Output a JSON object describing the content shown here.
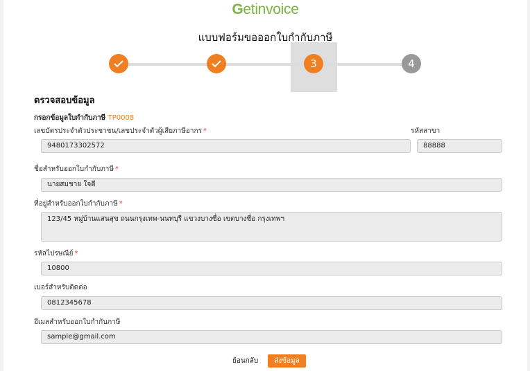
{
  "logo": {
    "g": "G",
    "rest": "etinvoice"
  },
  "form_title": "แบบฟอร์มขอออกใบกำกับภาษี",
  "steps": [
    {
      "state": "done",
      "label": ""
    },
    {
      "state": "done",
      "label": ""
    },
    {
      "state": "active",
      "label": "3"
    },
    {
      "state": "todo",
      "label": "4"
    }
  ],
  "section_title": "ตรวจสอบข้อมูล",
  "sub_title": {
    "text": "กรอกข้อมูลใบกำกับภาษี",
    "code": "TP0008"
  },
  "fields": {
    "tax_id": {
      "label": "เลขบัตรประจำตัวประชาชน/เลขประจำตัวผู้เสียภาษีอากร",
      "required": "*",
      "value": "9480173302572"
    },
    "branch": {
      "label": "รหัสสาขา",
      "value": "88888"
    },
    "name": {
      "label": "ชื่อสำหรับออกใบกำกับภาษี",
      "required": "*",
      "value": "นายสมชาย ใจดี"
    },
    "address": {
      "label": "ที่อยู่สำหรับออกใบกำกับภาษี",
      "required": "*",
      "value": "123/45 หมู่บ้านแสนสุข ถนนกรุงเทพ-นนทบุรี แขวงบางซื่อ เขตบางซื่อ กรุงเทพฯ"
    },
    "postcode": {
      "label": "รหัสไปรษณีย์",
      "required": "*",
      "value": "10800"
    },
    "phone": {
      "label": "เบอร์สำหรับติดต่อ",
      "value": "0812345678"
    },
    "email": {
      "label": "อีเมลสำหรับออกใบกำกับภาษี",
      "value": "sample@gmail.com"
    }
  },
  "buttons": {
    "back": "ย้อนกลับ",
    "send": "ส่งข้อมูล"
  },
  "colors": {
    "accent": "#f07f22",
    "brand": "#7cb342",
    "step_todo": "#999999",
    "required": "#e53935"
  }
}
